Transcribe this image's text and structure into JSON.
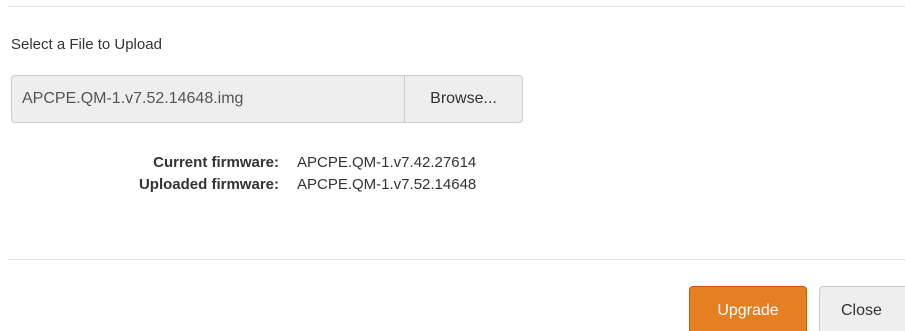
{
  "upload": {
    "label": "Select a File to Upload",
    "file_value": "APCPE.QM-1.v7.52.14648.img",
    "browse_label": "Browse..."
  },
  "firmware": {
    "current_label": "Current firmware:",
    "current_value": "APCPE.QM-1.v7.42.27614",
    "uploaded_label": "Uploaded firmware:",
    "uploaded_value": "APCPE.QM-1.v7.52.14648"
  },
  "footer": {
    "upgrade_label": "Upgrade",
    "close_label": "Close"
  },
  "colors": {
    "accent": "#e67e22",
    "button_bg": "#eeeeee"
  }
}
